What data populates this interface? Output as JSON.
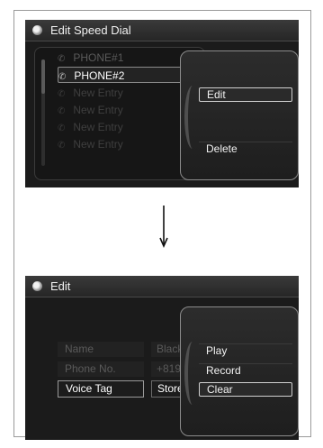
{
  "top_screen": {
    "title": "Edit Speed Dial",
    "entries": [
      {
        "label": "PHONE#1",
        "state": "dim"
      },
      {
        "label": "PHONE#2",
        "state": "selected"
      },
      {
        "label": "New Entry",
        "state": "faint"
      },
      {
        "label": "New Entry",
        "state": "faint"
      },
      {
        "label": "New Entry",
        "state": "faint"
      },
      {
        "label": "New Entry",
        "state": "faint"
      }
    ],
    "menu": {
      "edit_label": "Edit",
      "delete_label": "Delete",
      "highlighted": "Edit"
    }
  },
  "transition_arrow": "down-arrow-icon",
  "bottom_screen": {
    "title": "Edit",
    "fields": [
      {
        "label": "Name",
        "value": "Black",
        "state": "dim"
      },
      {
        "label": "Phone No.",
        "value": "+819",
        "state": "dim"
      },
      {
        "label": "Voice Tag",
        "value": "Store",
        "state": "active"
      }
    ],
    "menu": {
      "play_label": "Play",
      "record_label": "Record",
      "clear_label": "Clear",
      "highlighted": "Clear"
    }
  },
  "colors": {
    "screen_bg": "#1b1b1b",
    "text_active": "#ffffff",
    "text_dim": "#5a5a5a",
    "highlight_border": "#d0d0d0"
  }
}
